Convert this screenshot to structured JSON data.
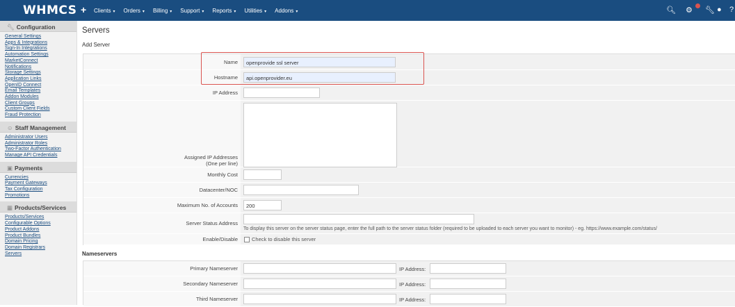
{
  "topbar": {
    "logo": "WHMCS",
    "nav": [
      "Clients",
      "Orders",
      "Billing",
      "Support",
      "Reports",
      "Utilities",
      "Addons"
    ],
    "colors": {
      "bar": "#1a4d80",
      "badge": "#d9534f"
    }
  },
  "sidebar": {
    "sections": [
      {
        "title": "Configuration",
        "icon": "wrench-icon",
        "links": [
          "General Settings",
          "Apps & Integrations",
          "Sign-In Integrations",
          "Automation Settings",
          "MarketConnect",
          "Notifications",
          "Storage Settings",
          "Application Links",
          "OpenID Connect",
          "Email Templates",
          "Addon Modules",
          "Client Groups",
          "Custom Client Fields",
          "Fraud Protection"
        ]
      },
      {
        "title": "Staff Management",
        "icon": "users-icon",
        "links": [
          "Administrator Users",
          "Administrator Roles",
          "Two-Factor Authentication",
          "Manage API Credentials"
        ]
      },
      {
        "title": "Payments",
        "icon": "payments-icon",
        "links": [
          "Currencies",
          "Payment Gateways",
          "Tax Configuration",
          "Promotions"
        ]
      },
      {
        "title": "Products/Services",
        "icon": "box-icon",
        "links": [
          "Products/Services",
          "Configurable Options",
          "Product Addons",
          "Product Bundles",
          "Domain Pricing",
          "Domain Registrars",
          "Servers"
        ]
      }
    ]
  },
  "main": {
    "title": "Servers",
    "subtitle": "Add Server",
    "form": {
      "name_label": "Name",
      "name_value": "openprovide ssl server",
      "hostname_label": "Hostname",
      "hostname_value": "api.openprovider.eu",
      "ip_label": "IP Address",
      "assigned_label_1": "Assigned IP Addresses",
      "assigned_label_2": "(One per line)",
      "cost_label": "Monthly Cost",
      "datacenter_label": "Datacenter/NOC",
      "max_accounts_label": "Maximum No. of Accounts",
      "max_accounts_value": "200",
      "status_label": "Server Status Address",
      "status_help": "To display this server on the server status page, enter the full path to the server status folder (required to be uploaded to each server you want to monitor) - eg. https://www.example.com/status/",
      "enable_label": "Enable/Disable",
      "enable_help": "Check to disable this server"
    },
    "nameservers": {
      "title": "Nameservers",
      "ip_label": "IP Address:",
      "rows": [
        "Primary Nameserver",
        "Secondary Nameserver",
        "Third Nameserver"
      ]
    }
  }
}
